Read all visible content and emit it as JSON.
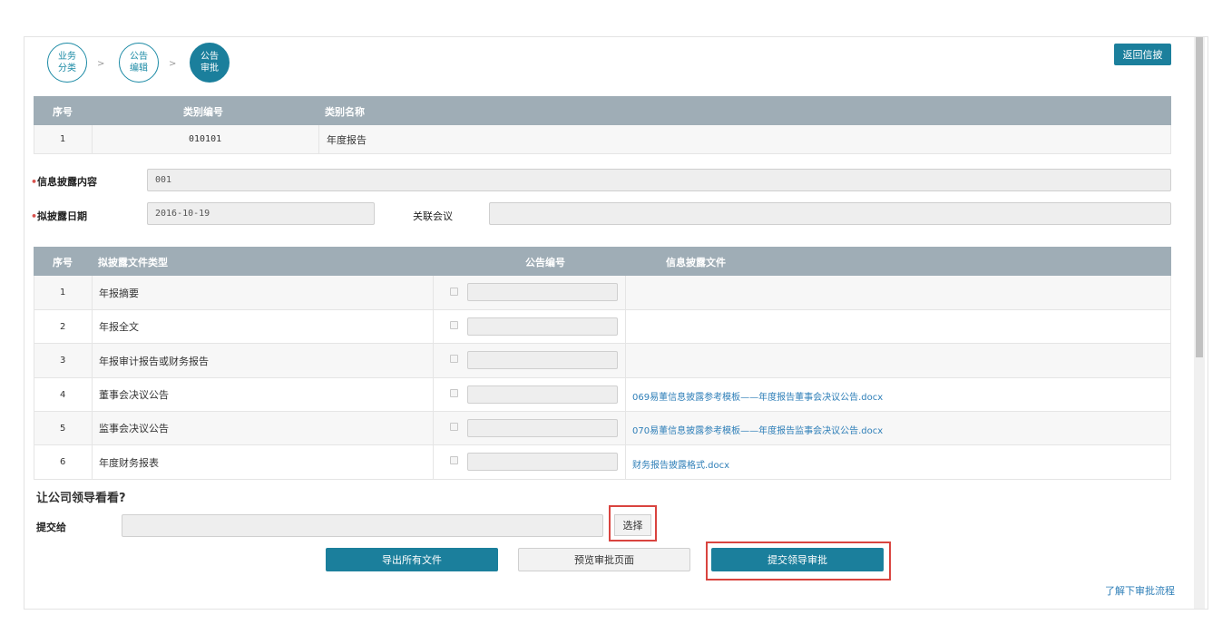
{
  "steps": [
    {
      "label": "业务分类"
    },
    {
      "label": "公告编辑"
    },
    {
      "label": "公告审批"
    }
  ],
  "step_separator": ">",
  "return_button": "返回信披",
  "category_table": {
    "headers": [
      "序号",
      "类别编号",
      "类别名称"
    ],
    "rows": [
      {
        "index": "1",
        "code": "010101",
        "name": "年度报告"
      }
    ]
  },
  "form": {
    "required_mark": "•",
    "content_label": "信息披露内容",
    "content_value": "001",
    "date_label": "拟披露日期",
    "date_value": "2016-10-19",
    "meeting_label": "关联会议",
    "meeting_value": ""
  },
  "file_table": {
    "headers": [
      "序号",
      "拟披露文件类型",
      "公告编号",
      "信息披露文件"
    ],
    "rows": [
      {
        "index": "1",
        "type": "年报摘要",
        "file": ""
      },
      {
        "index": "2",
        "type": "年报全文",
        "file": ""
      },
      {
        "index": "3",
        "type": "年报审计报告或财务报告",
        "file": ""
      },
      {
        "index": "4",
        "type": "董事会决议公告",
        "file": "069易董信息披露参考模板——年度报告董事会决议公告.docx"
      },
      {
        "index": "5",
        "type": "监事会决议公告",
        "file": "070易董信息披露参考模板——年度报告监事会决议公告.docx"
      },
      {
        "index": "6",
        "type": "年度财务报表",
        "file": "财务报告披露格式.docx"
      }
    ]
  },
  "approval": {
    "section_title": "让公司领导看看?",
    "submit_to_label": "提交给",
    "submit_to_value": "",
    "select_button": "选择"
  },
  "actions": {
    "export_all": "导出所有文件",
    "preview": "预览审批页面",
    "submit": "提交领导审批"
  },
  "help_link": "了解下审批流程",
  "colors": {
    "primary": "#1b7f9c",
    "header": "#9fadb6",
    "link": "#2f7fb8",
    "highlight": "#d9443f"
  }
}
